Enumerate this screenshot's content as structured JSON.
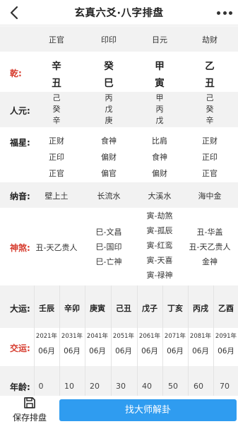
{
  "header": {
    "title": "玄真六爻·八字排盘"
  },
  "columns": {
    "shishen": [
      "正官",
      "印印",
      "日元",
      "劫财"
    ],
    "tiangan": [
      "辛",
      "癸",
      "甲",
      "乙"
    ],
    "dizhi": [
      "丑",
      "巳",
      "寅",
      "丑"
    ]
  },
  "labels": {
    "qian": "乾:",
    "renyuan": "人元:",
    "fuxing": "福星:",
    "nayin": "纳音:",
    "shensha": "神煞:",
    "dayun": "大运:",
    "jiaoyun": "交运:",
    "nianling": "年龄:"
  },
  "renyuan": [
    [
      "己",
      "癸",
      "辛"
    ],
    [
      "丙",
      "戊",
      "庚"
    ],
    [
      "甲",
      "丙",
      "戊"
    ],
    [
      "己",
      "癸",
      "辛"
    ]
  ],
  "fuxing": [
    [
      "正财",
      "正印",
      "正官"
    ],
    [
      "食神",
      "偏财",
      "偏官"
    ],
    [
      "比肩",
      "食神",
      "偏财"
    ],
    [
      "正财",
      "正印",
      "正官"
    ]
  ],
  "nayin": [
    "壁上土",
    "长流水",
    "大溪水",
    "海中金"
  ],
  "shensha": [
    [
      "丑-天乙贵人"
    ],
    [
      "巳-文昌",
      "巳-国印",
      "巳-亡神"
    ],
    [
      "寅-劫煞",
      "寅-孤辰",
      "寅-红鸾",
      "寅-天喜",
      "寅-禄神"
    ],
    [
      "丑-华盖",
      "丑-天乙贵人",
      "金神"
    ]
  ],
  "dayun": [
    "壬辰",
    "辛卯",
    "庚寅",
    "己丑",
    "戊子",
    "丁亥",
    "丙戌",
    "乙酉"
  ],
  "jiaoyun_years": [
    "2021年",
    "2031年",
    "2041年",
    "2051年",
    "2061年",
    "2071年",
    "2081年",
    "2091年"
  ],
  "jiaoyun_month": "06月",
  "ages": [
    "0",
    "10",
    "20",
    "30",
    "40",
    "50",
    "60",
    "70"
  ],
  "footer": {
    "save_label": "保存排盘",
    "cta_label": "找大师解卦"
  },
  "colors": {
    "accent_red": "#d63a2c",
    "button_blue": "#2f9cf0",
    "row_gray": "#f2f2f2"
  }
}
